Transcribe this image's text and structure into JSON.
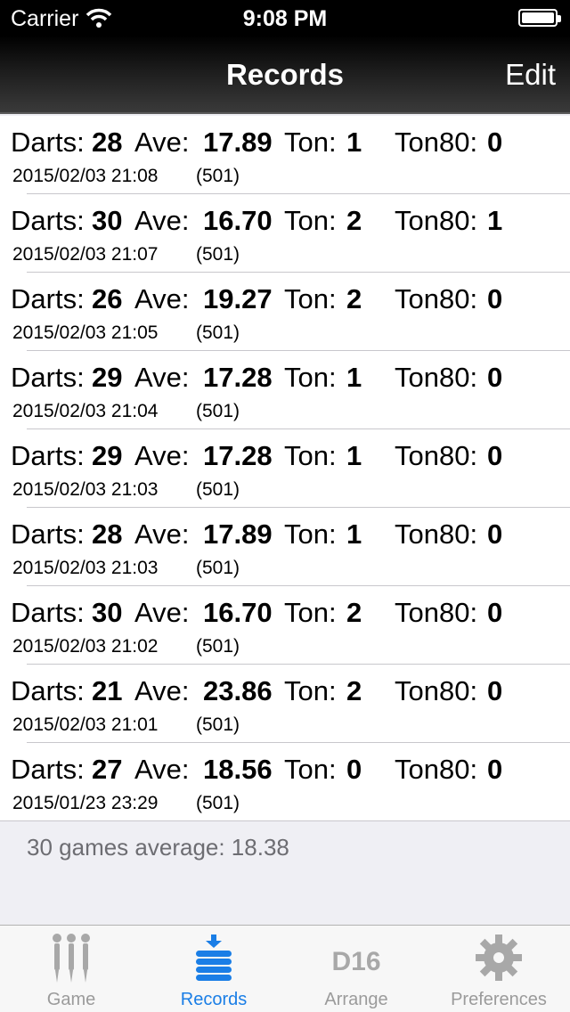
{
  "status": {
    "carrier": "Carrier",
    "time": "9:08 PM"
  },
  "nav": {
    "title": "Records",
    "edit": "Edit"
  },
  "labels": {
    "darts": "Darts:",
    "ave": "Ave:",
    "ton": "Ton:",
    "ton80": "Ton80:"
  },
  "records": [
    {
      "darts": "28",
      "ave": "17.89",
      "ton": "1",
      "ton80": "0",
      "date": "2015/02/03 21:08",
      "mode": "(501)"
    },
    {
      "darts": "30",
      "ave": "16.70",
      "ton": "2",
      "ton80": "1",
      "date": "2015/02/03 21:07",
      "mode": "(501)"
    },
    {
      "darts": "26",
      "ave": "19.27",
      "ton": "2",
      "ton80": "0",
      "date": "2015/02/03 21:05",
      "mode": "(501)"
    },
    {
      "darts": "29",
      "ave": "17.28",
      "ton": "1",
      "ton80": "0",
      "date": "2015/02/03 21:04",
      "mode": "(501)"
    },
    {
      "darts": "29",
      "ave": "17.28",
      "ton": "1",
      "ton80": "0",
      "date": "2015/02/03 21:03",
      "mode": "(501)"
    },
    {
      "darts": "28",
      "ave": "17.89",
      "ton": "1",
      "ton80": "0",
      "date": "2015/02/03 21:03",
      "mode": "(501)"
    },
    {
      "darts": "30",
      "ave": "16.70",
      "ton": "2",
      "ton80": "0",
      "date": "2015/02/03 21:02",
      "mode": "(501)"
    },
    {
      "darts": "21",
      "ave": "23.86",
      "ton": "2",
      "ton80": "0",
      "date": "2015/02/03 21:01",
      "mode": "(501)"
    },
    {
      "darts": "27",
      "ave": "18.56",
      "ton": "0",
      "ton80": "0",
      "date": "2015/01/23 23:29",
      "mode": "(501)"
    }
  ],
  "summary": "30 games average: 18.38",
  "tabs": [
    {
      "label": "Game",
      "icon": "darts-icon",
      "active": false
    },
    {
      "label": "Records",
      "icon": "records-stack-icon",
      "active": true
    },
    {
      "label": "Arrange",
      "icon": "d16-icon",
      "badge": "D16",
      "active": false
    },
    {
      "label": "Preferences",
      "icon": "gear-icon",
      "active": false
    }
  ],
  "colors": {
    "accent": "#1a7ee6",
    "inactive": "#9b9b9b"
  }
}
